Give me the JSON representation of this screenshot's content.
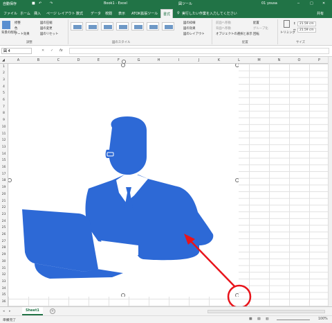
{
  "titlebar": {
    "quick_save": "自動保存",
    "doc_title": "Book1 - Excel",
    "tool_context": "図ツール",
    "user": "01 yousa"
  },
  "tabs": [
    "ファイル",
    "ホーム",
    "挿入",
    "ページ レイアウト",
    "数式",
    "データ",
    "校閲",
    "表示",
    "ATOK拡張ツール",
    "書式"
  ],
  "tell_me": "実行したい作業を入力してください",
  "share": "共有",
  "ribbon": {
    "adjust": {
      "bg_remove": "背景の削除",
      "corrections": "修整",
      "color": "色",
      "art_effects": "アート効果",
      "compress": "図の圧縮",
      "change": "図の変更",
      "reset": "図のリセット",
      "group_label": "調整"
    },
    "styles": {
      "group_label": "図のスタイル"
    },
    "style_cmds": [
      "図の枠線",
      "図の効果",
      "図のレイアウト"
    ],
    "arrange": {
      "front": "前面へ移動",
      "back": "背面へ移動",
      "pane": "オブジェクトの選択と表示",
      "align": "配置",
      "group": "グループ化",
      "rotate": "回転",
      "group_label": "配置"
    },
    "size": {
      "crop": "トリミング",
      "height": "21.59 cm",
      "width": "21.59 cm",
      "group_label": "サイズ"
    }
  },
  "formula_bar": {
    "name_box": "図 4",
    "fx": "fx"
  },
  "columns": [
    "A",
    "B",
    "C",
    "D",
    "E",
    "F",
    "G",
    "H",
    "I",
    "J",
    "K",
    "L",
    "M",
    "N",
    "O",
    "P"
  ],
  "rows": [
    "1",
    "2",
    "3",
    "4",
    "5",
    "6",
    "7",
    "8",
    "9",
    "10",
    "11",
    "12",
    "13",
    "14",
    "15",
    "16",
    "17",
    "18",
    "19",
    "20",
    "21",
    "22",
    "23",
    "24",
    "25",
    "26",
    "27",
    "28",
    "29",
    "30",
    "31",
    "32",
    "33",
    "34",
    "35",
    "36"
  ],
  "sheet_tab": "Sheet1",
  "add_sheet": "+",
  "status": {
    "ready": "準備完了",
    "zoom": "100%"
  },
  "colors": {
    "excel_green": "#217346",
    "silhouette": "#2d69d6",
    "annotation_red": "#e8141b"
  }
}
